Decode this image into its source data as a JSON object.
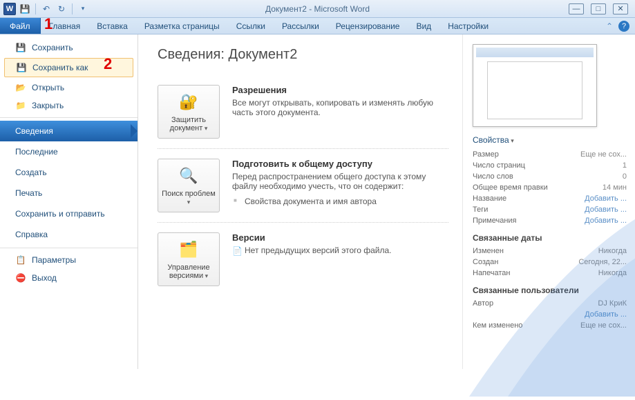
{
  "window": {
    "title": "Документ2 - Microsoft Word"
  },
  "annotations": {
    "one": "1",
    "two": "2"
  },
  "ribbon": {
    "file": "Файл",
    "tabs": [
      "Главная",
      "Вставка",
      "Разметка страницы",
      "Ссылки",
      "Рассылки",
      "Рецензирование",
      "Вид",
      "Настройки"
    ]
  },
  "backstage_menu": {
    "save": "Сохранить",
    "save_as": "Сохранить как",
    "open": "Открыть",
    "close": "Закрыть",
    "info": "Сведения",
    "recent": "Последние",
    "new": "Создать",
    "print": "Печать",
    "share": "Сохранить и отправить",
    "help": "Справка",
    "options": "Параметры",
    "exit": "Выход"
  },
  "info": {
    "heading": "Сведения: Документ2",
    "permissions": {
      "button": "Защитить документ",
      "title": "Разрешения",
      "body": "Все могут открывать, копировать и изменять любую часть этого документа."
    },
    "prepare": {
      "button": "Поиск проблем",
      "title": "Подготовить к общему доступу",
      "body": "Перед распространением общего доступа к этому файлу необходимо учесть, что он содержит:",
      "sub": "Свойства документа и имя автора"
    },
    "versions": {
      "button": "Управление версиями",
      "title": "Версии",
      "body": "Нет предыдущих версий этого файла."
    }
  },
  "props": {
    "header": "Свойства",
    "size_k": "Размер",
    "size_v": "Еще не сох...",
    "pages_k": "Число страниц",
    "pages_v": "1",
    "words_k": "Число слов",
    "words_v": "0",
    "edit_k": "Общее время правки",
    "edit_v": "14 мин",
    "title_k": "Название",
    "title_v": "Добавить ...",
    "tags_k": "Теги",
    "tags_v": "Добавить ...",
    "notes_k": "Примечания",
    "notes_v": "Добавить ...",
    "dates_h": "Связанные даты",
    "modified_k": "Изменен",
    "modified_v": "Никогда",
    "created_k": "Создан",
    "created_v": "Сегодня, 22...",
    "printed_k": "Напечатан",
    "printed_v": "Никогда",
    "people_h": "Связанные пользователи",
    "author_k": "Автор",
    "author_v": "DJ КриК",
    "author_add": "Добавить ...",
    "lastmod_k": "Кем изменено",
    "lastmod_v": "Еще не сох..."
  }
}
